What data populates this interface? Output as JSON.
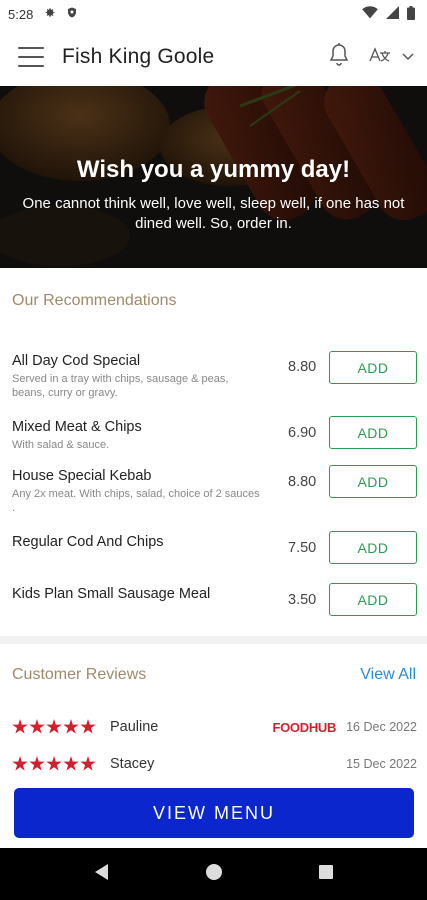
{
  "status_bar": {
    "time": "5:28"
  },
  "app_bar": {
    "title": "Fish King Goole"
  },
  "hero": {
    "title": "Wish you a yummy day!",
    "subtitle": "One cannot think well, love well, sleep well, if one has not dined well. So, order in."
  },
  "recommendations": {
    "title": "Our Recommendations",
    "add_label": "ADD",
    "items": [
      {
        "name": "All Day Cod Special",
        "description": "Served in a tray with chips, sausage & peas, beans, curry or gravy.",
        "price": "8.80"
      },
      {
        "name": "Mixed Meat & Chips",
        "description": "With salad & sauce.",
        "price": "6.90"
      },
      {
        "name": "House Special Kebab",
        "description": "Any 2x meat. With chips, salad, choice of 2 sauces .",
        "price": "8.80"
      },
      {
        "name": "Regular Cod And Chips",
        "description": "",
        "price": "7.50"
      },
      {
        "name": "Kids Plan Small Sausage Meal",
        "description": "",
        "price": "3.50"
      }
    ]
  },
  "reviews": {
    "title": "Customer Reviews",
    "view_all": "View All",
    "items": [
      {
        "name": "Pauline",
        "rating": 5,
        "source": "FOODHUB",
        "date": "16 Dec 2022"
      },
      {
        "name": "Stacey",
        "rating": 5,
        "source": "",
        "date": "15 Dec 2022"
      }
    ]
  },
  "view_menu_label": "VIEW MENU",
  "colors": {
    "accent_green": "#2e9b53",
    "primary_blue": "#0a26cc",
    "star_red": "#d61f2c",
    "section_title": "#a08a6a",
    "link_blue": "#2a8bd0"
  }
}
